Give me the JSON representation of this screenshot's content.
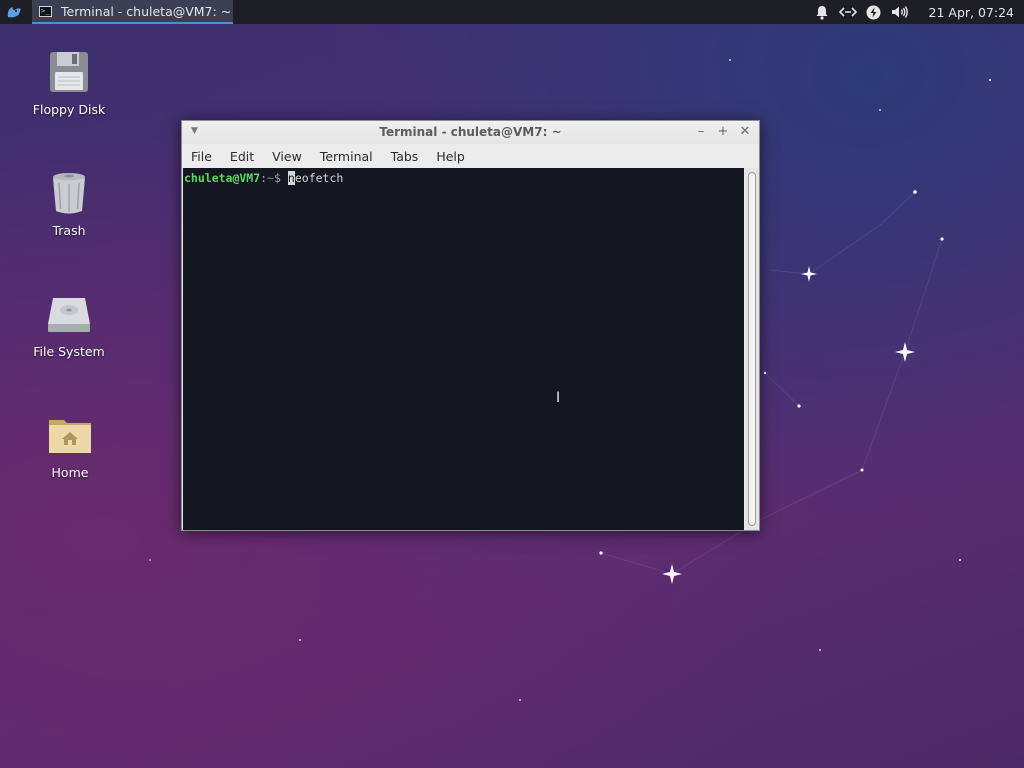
{
  "panel": {
    "task_title": "Terminal - chuleta@VM7: ~",
    "clock": "21 Apr, 07:24",
    "icons": [
      "whisker-menu-icon",
      "terminal-icon",
      "bell-icon",
      "network-icon",
      "power-icon",
      "volume-icon"
    ]
  },
  "desktop": {
    "icons": [
      {
        "label": "Floppy Disk",
        "icon": "floppy-disk-icon"
      },
      {
        "label": "Trash",
        "icon": "trash-icon"
      },
      {
        "label": "File System",
        "icon": "drive-icon"
      },
      {
        "label": "Home",
        "icon": "home-folder-icon"
      }
    ]
  },
  "terminal": {
    "title": "Terminal - chuleta@VM7: ~",
    "menu": [
      "File",
      "Edit",
      "View",
      "Terminal",
      "Tabs",
      "Help"
    ],
    "prompt_user": "chuleta@VM7",
    "prompt_sep": ":",
    "prompt_path": "~",
    "prompt_symbol": "$ ",
    "command_first": "n",
    "command_rest": "eofetch"
  },
  "colors": {
    "panel_bg": "#1e1e26",
    "terminal_bg": "#131722",
    "prompt_user": "#5fd75f",
    "accent": "#4a90d9"
  }
}
